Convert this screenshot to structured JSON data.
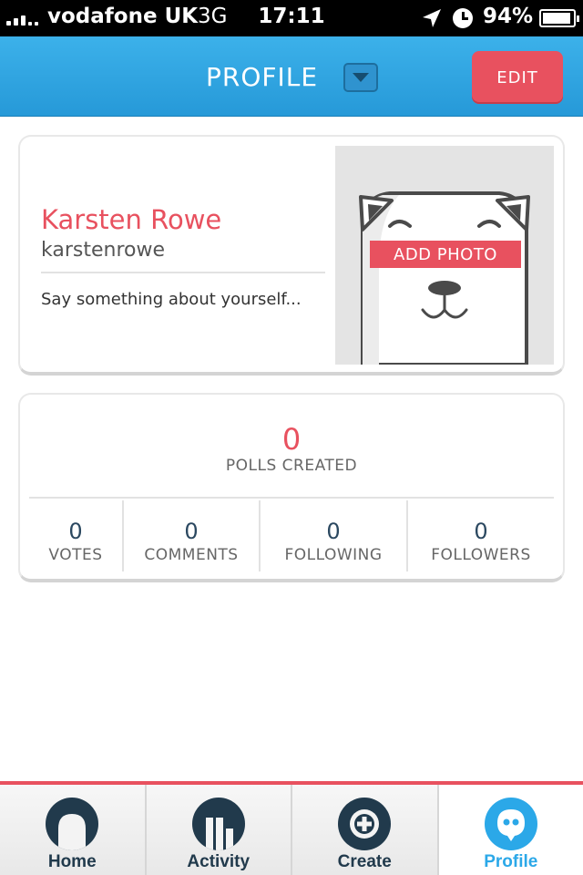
{
  "status_bar": {
    "carrier": "vodafone UK",
    "network": "3G",
    "time": "17:11",
    "battery": "94%",
    "battery_level": 0.94,
    "icons": [
      "signal-icon",
      "location-arrow-icon",
      "alarm-clock-icon",
      "battery-icon"
    ]
  },
  "nav": {
    "title": "PROFILE",
    "dropdown_icon": "chevron-down-icon",
    "edit_label": "EDIT"
  },
  "profile": {
    "name": "Karsten Rowe",
    "username": "karstenrowe",
    "bio_placeholder": "Say something about yourself...",
    "photo_label": "ADD PHOTO"
  },
  "stats": {
    "polls_created": {
      "value": "0",
      "label": "POLLS CREATED"
    },
    "items": [
      {
        "value": "0",
        "label": "VOTES"
      },
      {
        "value": "0",
        "label": "COMMENTS"
      },
      {
        "value": "0",
        "label": "FOLLOWING"
      },
      {
        "value": "0",
        "label": "FOLLOWERS"
      }
    ]
  },
  "tabs": [
    {
      "label": "Home",
      "icon": "home-icon",
      "active": false
    },
    {
      "label": "Activity",
      "icon": "activity-icon",
      "active": false
    },
    {
      "label": "Create",
      "icon": "plus-icon",
      "active": false
    },
    {
      "label": "Profile",
      "icon": "profile-icon",
      "active": true
    }
  ],
  "colors": {
    "accent": "#e8515f",
    "nav_blue": "#2ba8e8",
    "dark_navy": "#213a4c",
    "status_bar": "#000000"
  }
}
